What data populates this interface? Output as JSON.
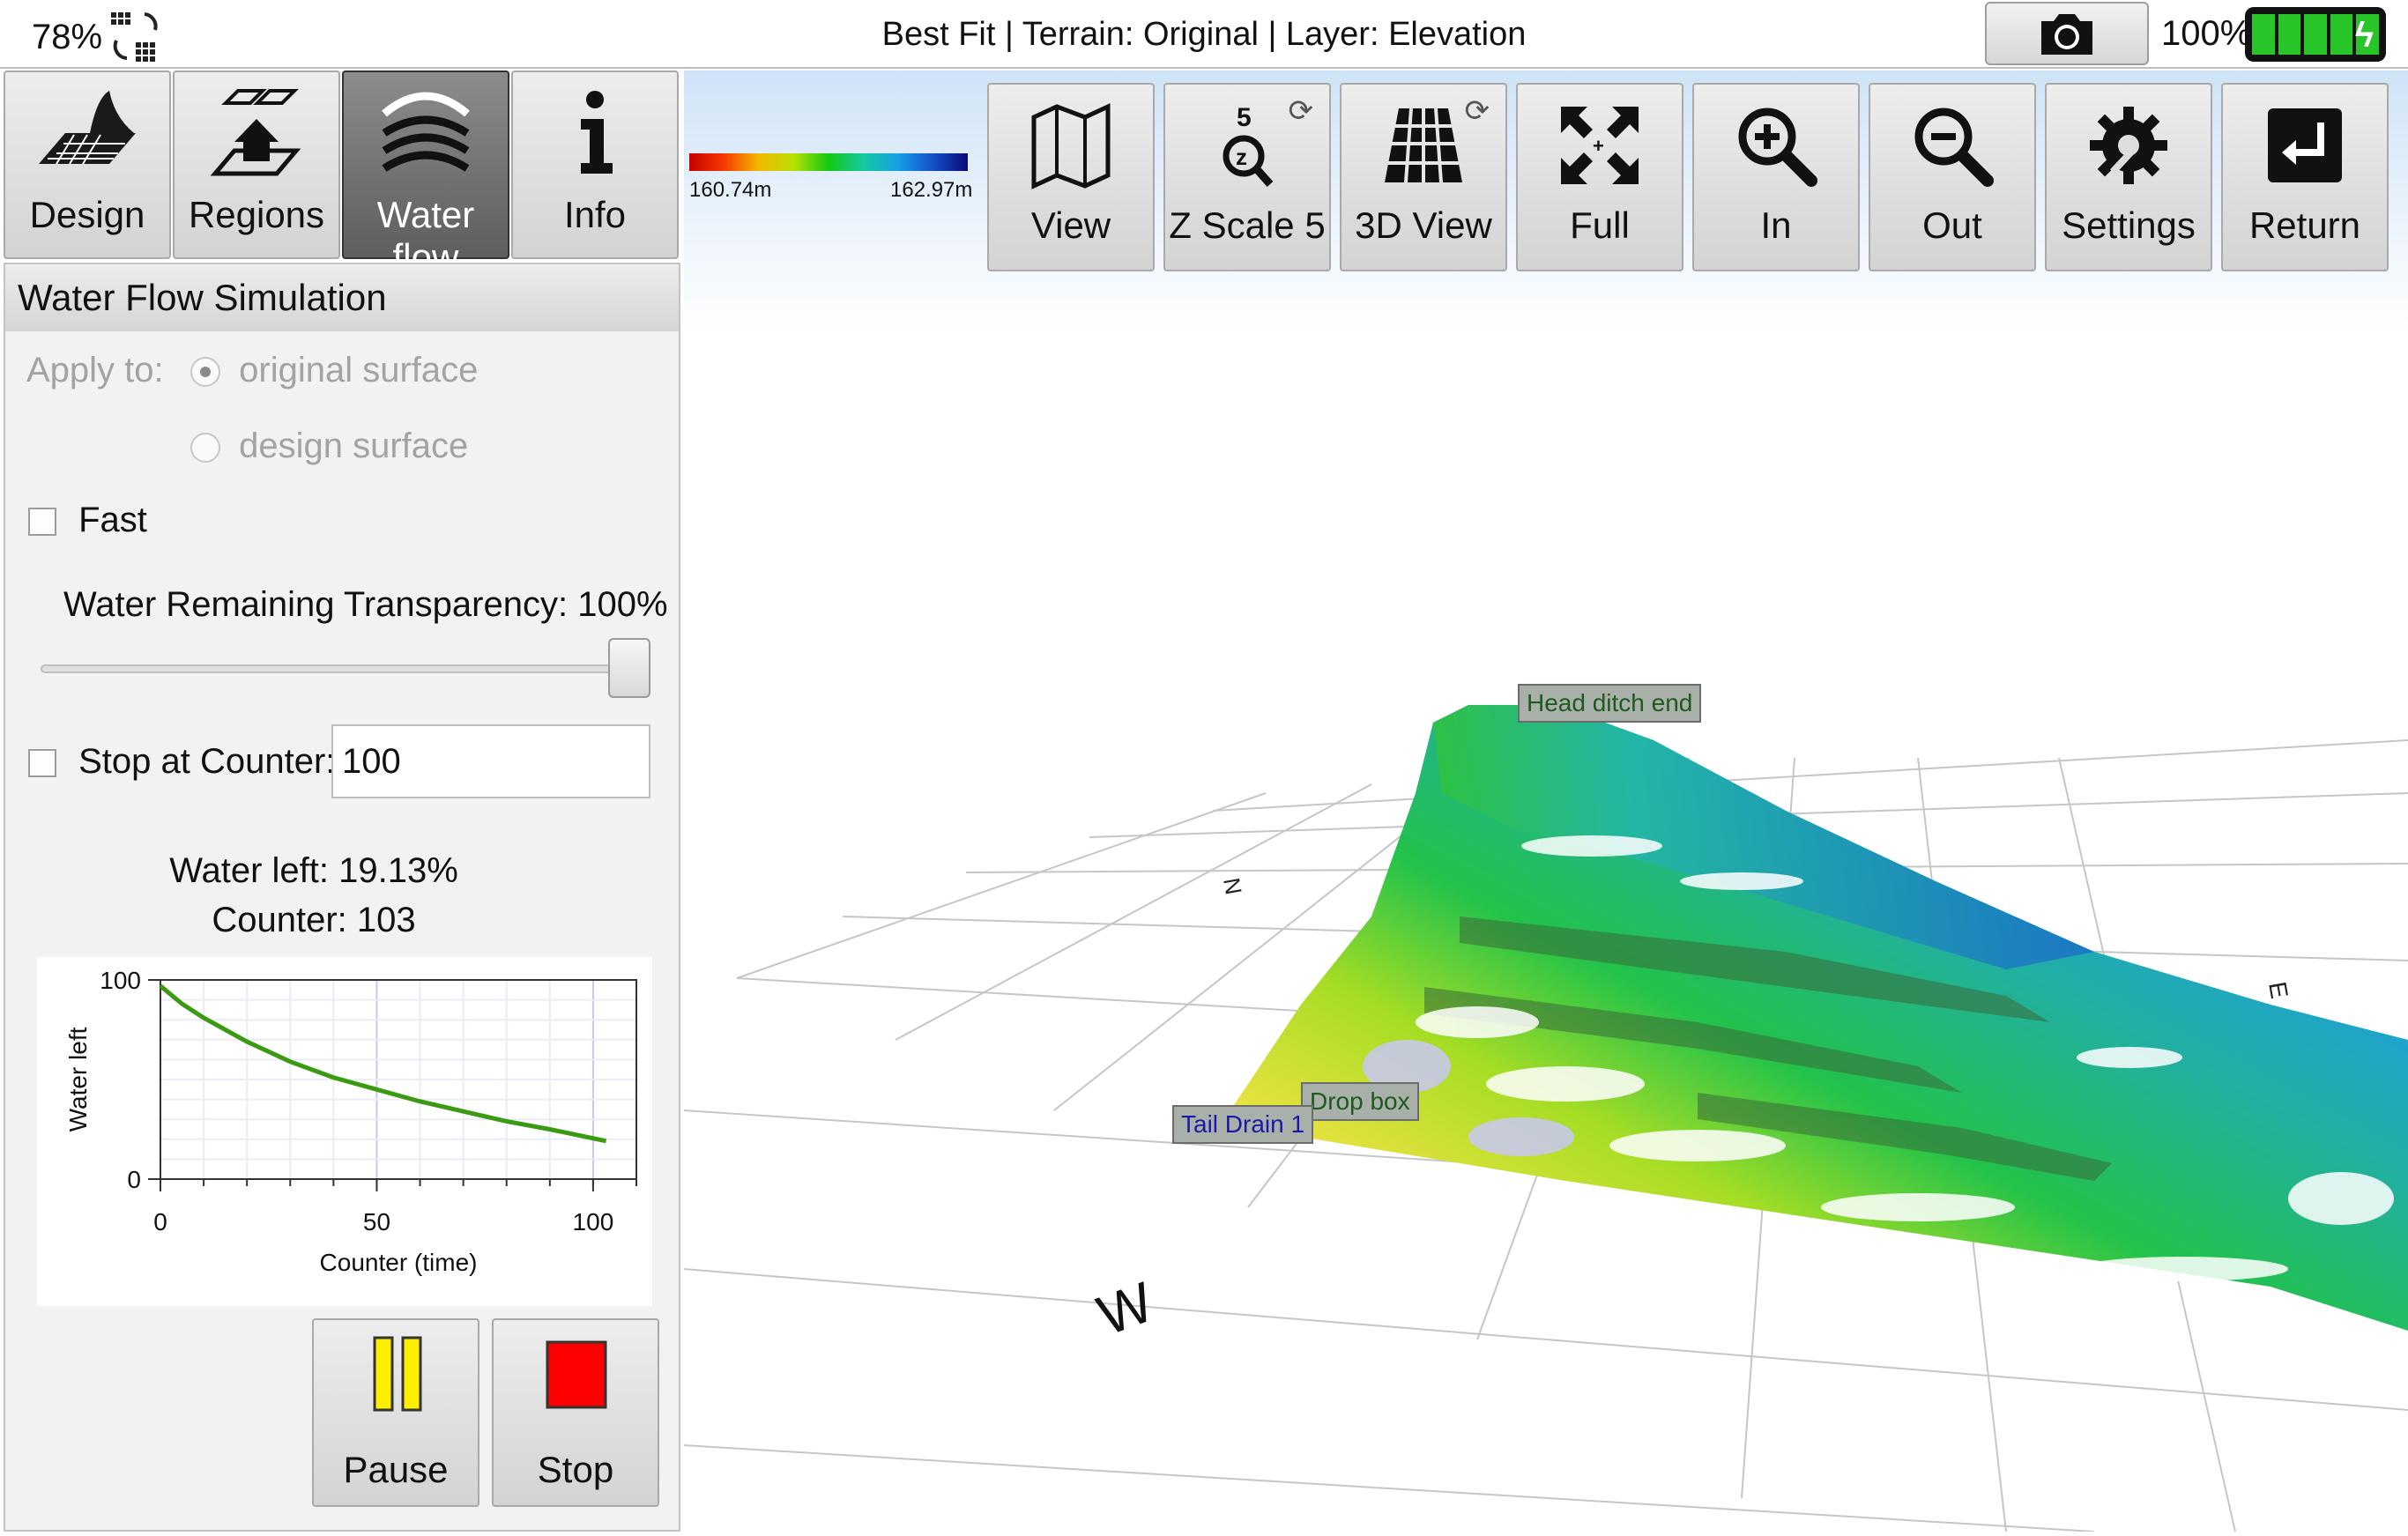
{
  "status": {
    "signal_percent": "78%",
    "title": "Best Fit | Terrain: Original | Layer: Elevation",
    "battery_percent": "100%"
  },
  "tabs": [
    {
      "label": "Design",
      "icon": "design-icon"
    },
    {
      "label": "Regions",
      "icon": "regions-icon"
    },
    {
      "label": "Water flow",
      "icon": "water-flow-icon",
      "active": true
    },
    {
      "label": "Info",
      "icon": "info-icon"
    }
  ],
  "panel": {
    "title": "Water Flow Simulation",
    "apply_to_label": "Apply to:",
    "option_original": "original surface",
    "option_design": "design surface",
    "fast_label": "Fast",
    "transparency_label": "Water Remaining Transparency: 100%",
    "transparency_value": 1.0,
    "stop_at_counter_label": "Stop at Counter:",
    "stop_at_counter_value": "100",
    "water_left": "Water left: 19.13%",
    "counter": "Counter: 103",
    "pause_label": "Pause",
    "stop_label": "Stop"
  },
  "chart_data": {
    "type": "line",
    "xlabel": "Counter (time)",
    "ylabel": "Water left",
    "xlim": [
      0,
      110
    ],
    "ylim": [
      0,
      100
    ],
    "x_ticks": [
      "0",
      "50",
      "100"
    ],
    "y_ticks": [
      "0",
      "100"
    ],
    "grid": true,
    "series": [
      {
        "color": "#3a9a12",
        "x": [
          0,
          5,
          10,
          20,
          30,
          40,
          50,
          60,
          70,
          80,
          90,
          103
        ],
        "y": [
          97,
          88,
          81,
          69,
          59,
          51,
          45,
          39,
          34,
          29,
          25,
          19.13
        ]
      }
    ]
  },
  "toolbar": [
    {
      "label": "View",
      "icon": "map-icon"
    },
    {
      "label": "Z Scale 5",
      "icon": "z-scale-icon",
      "refresh": true
    },
    {
      "label": "3D View",
      "icon": "3d-grid-icon",
      "refresh": true
    },
    {
      "label": "Full",
      "icon": "full-extent-icon"
    },
    {
      "label": "In",
      "icon": "zoom-in-icon"
    },
    {
      "label": "Out",
      "icon": "zoom-out-icon"
    },
    {
      "label": "Settings",
      "icon": "settings-icon"
    },
    {
      "label": "Return",
      "icon": "return-icon"
    }
  ],
  "legend": {
    "min": "160.74m",
    "max": "162.97m"
  },
  "scene": {
    "labels": [
      "Head ditch end",
      "Drop box",
      "Tail Drain 1"
    ],
    "compass": [
      "N",
      "E",
      "W"
    ]
  },
  "colors": {
    "accent_green": "#28c528",
    "pause_yellow": "#ffee00",
    "stop_red": "#ff0000"
  }
}
